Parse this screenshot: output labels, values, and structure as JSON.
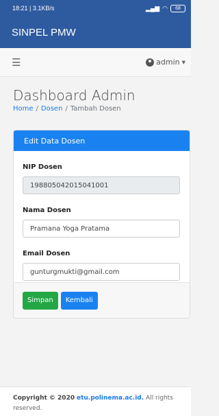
{
  "status_bar": {
    "time_info": "18:21 | 3.1KB/s",
    "battery": "68"
  },
  "app_bar": {
    "title": "SINPEL PMW"
  },
  "navbar": {
    "menu_icon": "hamburger-icon",
    "user": "admin"
  },
  "page": {
    "title": "Dashboard Admin",
    "breadcrumb": {
      "home": "Home",
      "sep1": "/",
      "dosen": "Dosen",
      "sep2": "/",
      "current": "Tambah Dosen"
    }
  },
  "form": {
    "header": "Edit Data Dosen",
    "nip_label": "NIP Dosen",
    "nip_value": "198805042015041001",
    "nama_label": "Nama Dosen",
    "nama_value": "Pramana Yoga Pratama",
    "email_label": "Email Dosen",
    "email_value": "gunturgmukti@gmail.com",
    "save_label": "Simpan",
    "back_label": "Kembali"
  },
  "footer": {
    "copyright": "Copyright © 2020",
    "site": "etu.polinema.ac.id.",
    "rights": "All rights reserved."
  },
  "colors": {
    "app_bar": "#2e5b9f",
    "primary": "#1a82f0",
    "success": "#23a745"
  }
}
